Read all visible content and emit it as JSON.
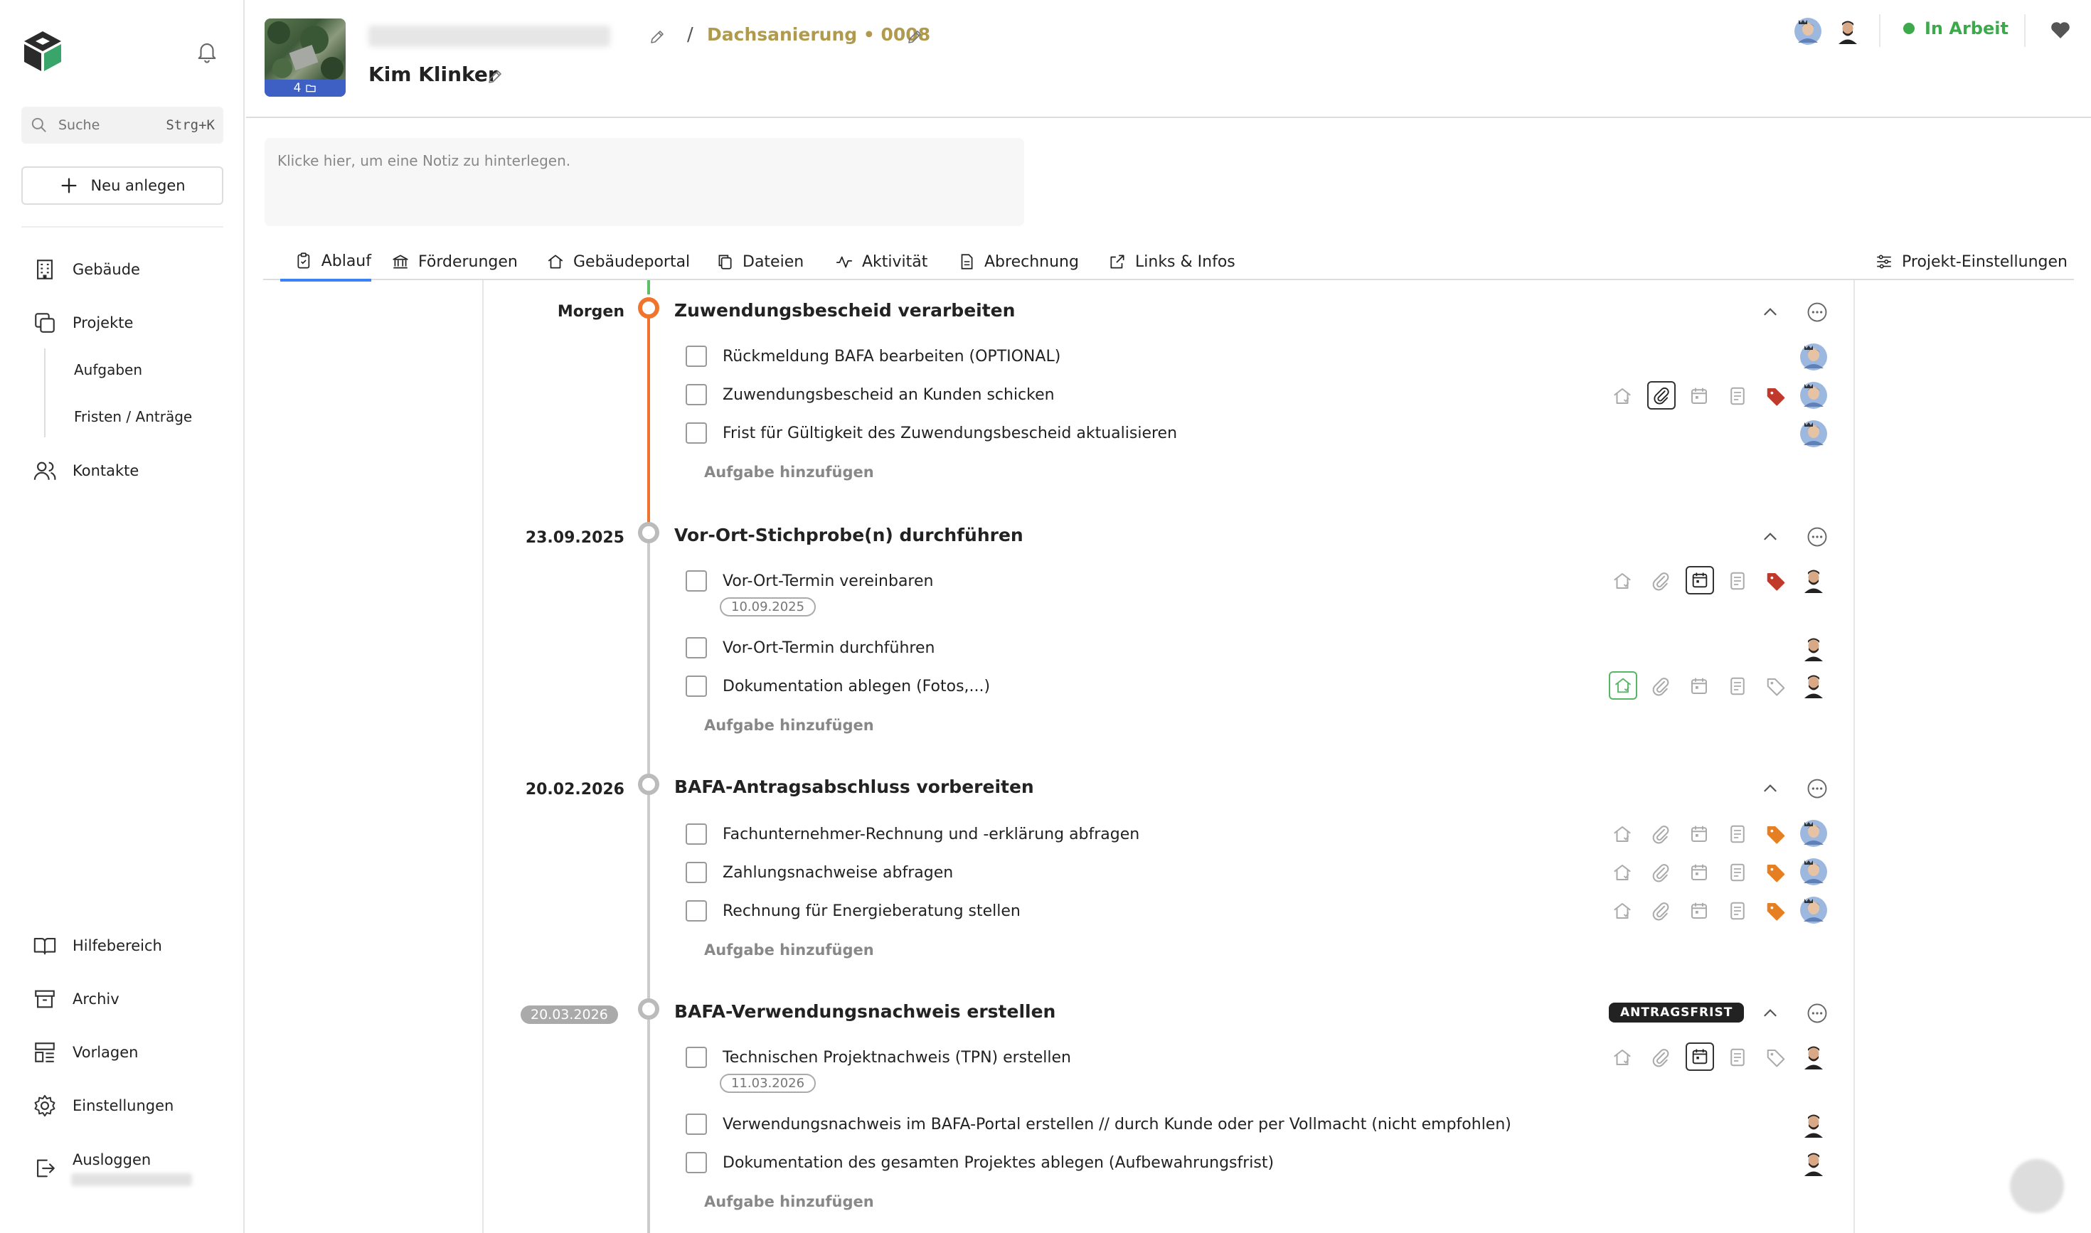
{
  "sidebar": {
    "search_placeholder": "Suche",
    "search_shortcut": "Strg+K",
    "new_label": "Neu anlegen",
    "nav": {
      "gebaeude": "Gebäude",
      "projekte": "Projekte",
      "aufgaben": "Aufgaben",
      "fristen": "Fristen / Anträge",
      "kontakte": "Kontakte",
      "hilfe": "Hilfebereich",
      "archiv": "Archiv",
      "vorlagen": "Vorlagen",
      "einstellungen": "Einstellungen",
      "ausloggen": "Ausloggen"
    }
  },
  "header": {
    "photo_count": "4",
    "project": "Dachsanierung • 0008",
    "customer": "Kim Klinker",
    "status": "In Arbeit",
    "status_color": "#3caa4b"
  },
  "note_placeholder": "Klicke hier, um eine Notiz zu hinterlegen.",
  "tabs": {
    "ablauf": "Ablauf",
    "foerderungen": "Förderungen",
    "gebaeudeportal": "Gebäudeportal",
    "dateien": "Dateien",
    "aktivitaet": "Aktivität",
    "abrechnung": "Abrechnung",
    "links": "Links & Infos",
    "settings": "Projekt-Einstellungen"
  },
  "add_task_label": "Aufgabe hinzufügen",
  "groups": [
    {
      "date": "Morgen",
      "title": "Zuwendungsbescheid verarbeiten",
      "tasks": [
        "Rückmeldung BAFA bearbeiten (OPTIONAL)",
        "Zuwendungsbescheid an Kunden schicken",
        "Frist für Gültigkeit des Zuwendungsbescheid aktualisieren"
      ]
    },
    {
      "date": "23.09.2025",
      "title": "Vor-Ort-Stichprobe(n) durchführen",
      "tasks": [
        "Vor-Ort-Termin vereinbaren",
        "Vor-Ort-Termin durchführen",
        "Dokumentation ablegen (Fotos,...)"
      ],
      "task_date": "10.09.2025"
    },
    {
      "date": "20.02.2026",
      "title": "BAFA-Antragsabschluss vorbereiten",
      "tasks": [
        "Fachunternehmer-Rechnung und -erklärung abfragen",
        "Zahlungsnachweise abfragen",
        "Rechnung für Energieberatung stellen"
      ]
    },
    {
      "date": "20.03.2026",
      "title": "BAFA-Verwendungsnachweis erstellen",
      "badge": "ANTRAGSFRIST",
      "tasks": [
        "Technischen Projektnachweis (TPN) erstellen",
        "Verwendungsnachweis im BAFA-Portal erstellen // durch Kunde oder per Vollmacht (nicht empfohlen)",
        "Dokumentation des gesamten Projektes ablegen (Aufbewahrungsfrist)"
      ],
      "task_date": "11.03.2026"
    }
  ],
  "colors": {
    "accent": "#3b82f6",
    "timeline_active": "#f0752c",
    "project_gold": "#b09a4e",
    "tag_red": "#c0392b",
    "tag_orange": "#e67e22"
  }
}
